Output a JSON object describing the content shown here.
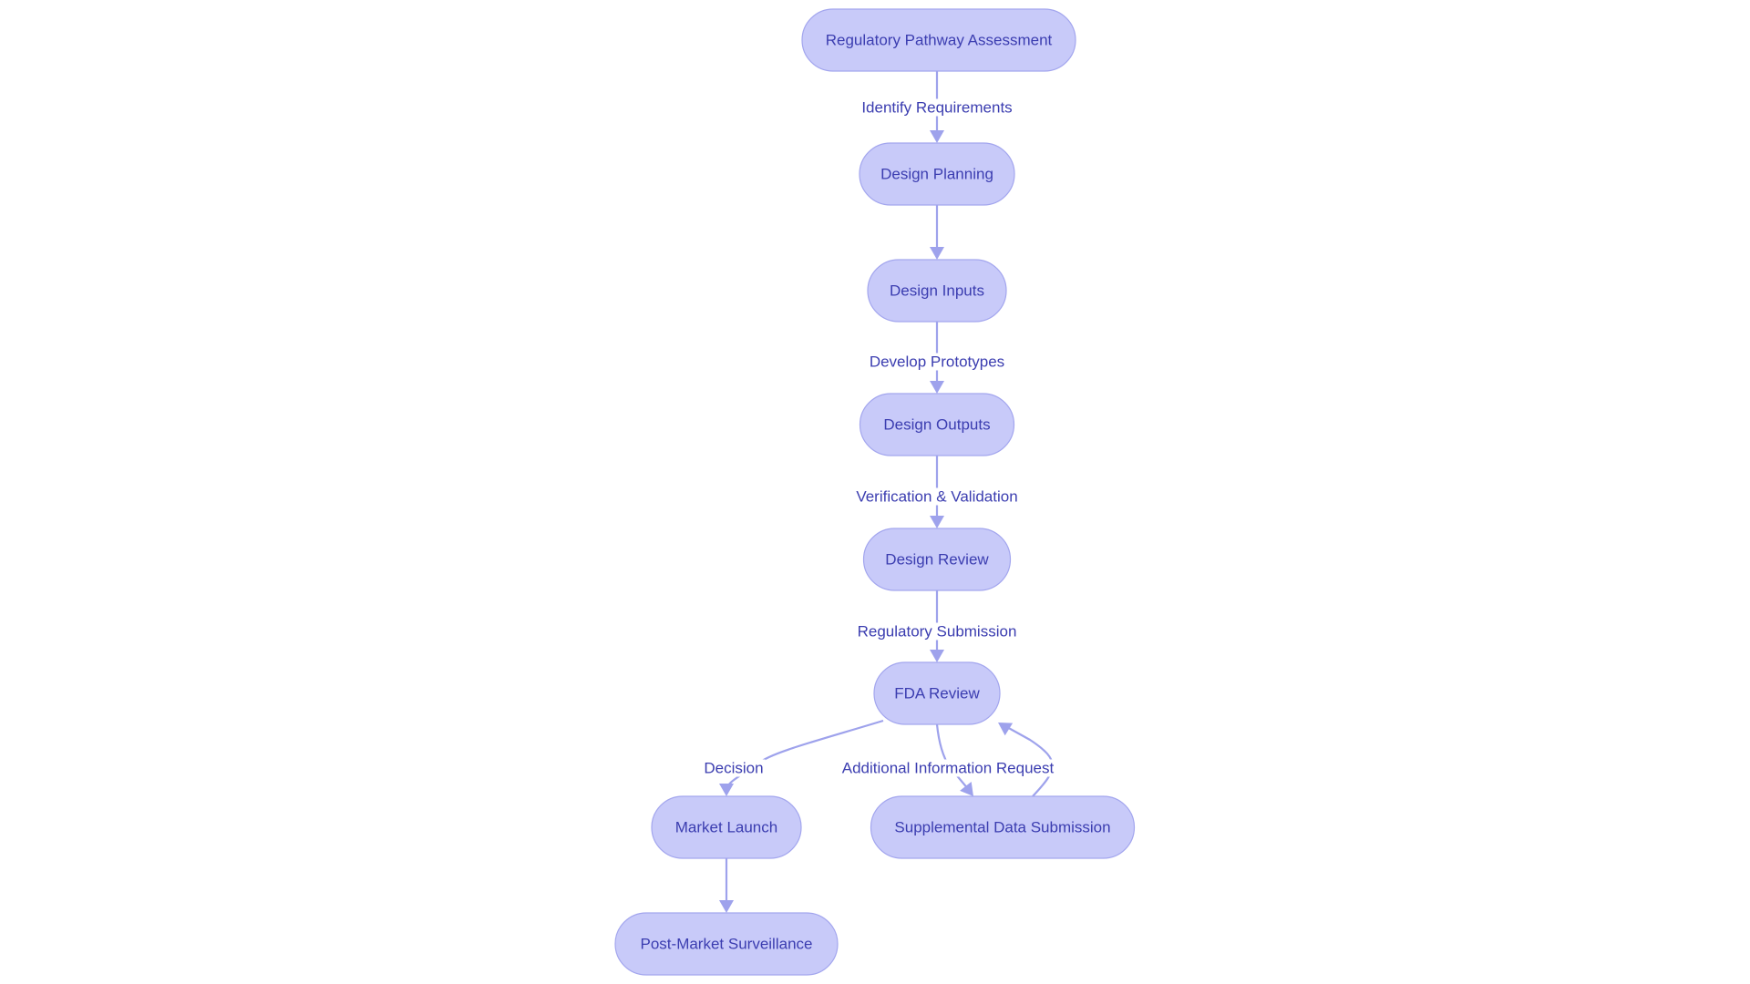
{
  "diagram": {
    "type": "flowchart",
    "direction": "top-down",
    "colors": {
      "node_fill": "#C8CAF9",
      "node_stroke": "#A3A6EE",
      "text": "#3B3DB0",
      "edge": "#9EA2EC",
      "background": "#FFFFFF"
    },
    "nodes": [
      {
        "id": "A",
        "label": "Regulatory Pathway Assessment"
      },
      {
        "id": "B",
        "label": "Design Planning"
      },
      {
        "id": "C",
        "label": "Design Inputs"
      },
      {
        "id": "D",
        "label": "Design Outputs"
      },
      {
        "id": "E",
        "label": "Design Review"
      },
      {
        "id": "F",
        "label": "FDA Review"
      },
      {
        "id": "G",
        "label": "Market Launch"
      },
      {
        "id": "H",
        "label": "Supplemental Data Submission"
      },
      {
        "id": "I",
        "label": "Post-Market Surveillance"
      }
    ],
    "edges": [
      {
        "from": "A",
        "to": "B",
        "label": "Identify Requirements"
      },
      {
        "from": "B",
        "to": "C",
        "label": ""
      },
      {
        "from": "C",
        "to": "D",
        "label": "Develop Prototypes"
      },
      {
        "from": "D",
        "to": "E",
        "label": "Verification & Validation"
      },
      {
        "from": "E",
        "to": "F",
        "label": "Regulatory Submission"
      },
      {
        "from": "F",
        "to": "G",
        "label": "Decision"
      },
      {
        "from": "F",
        "to": "H",
        "label": "Additional Information Request"
      },
      {
        "from": "H",
        "to": "F",
        "label": ""
      },
      {
        "from": "G",
        "to": "I",
        "label": ""
      }
    ]
  }
}
